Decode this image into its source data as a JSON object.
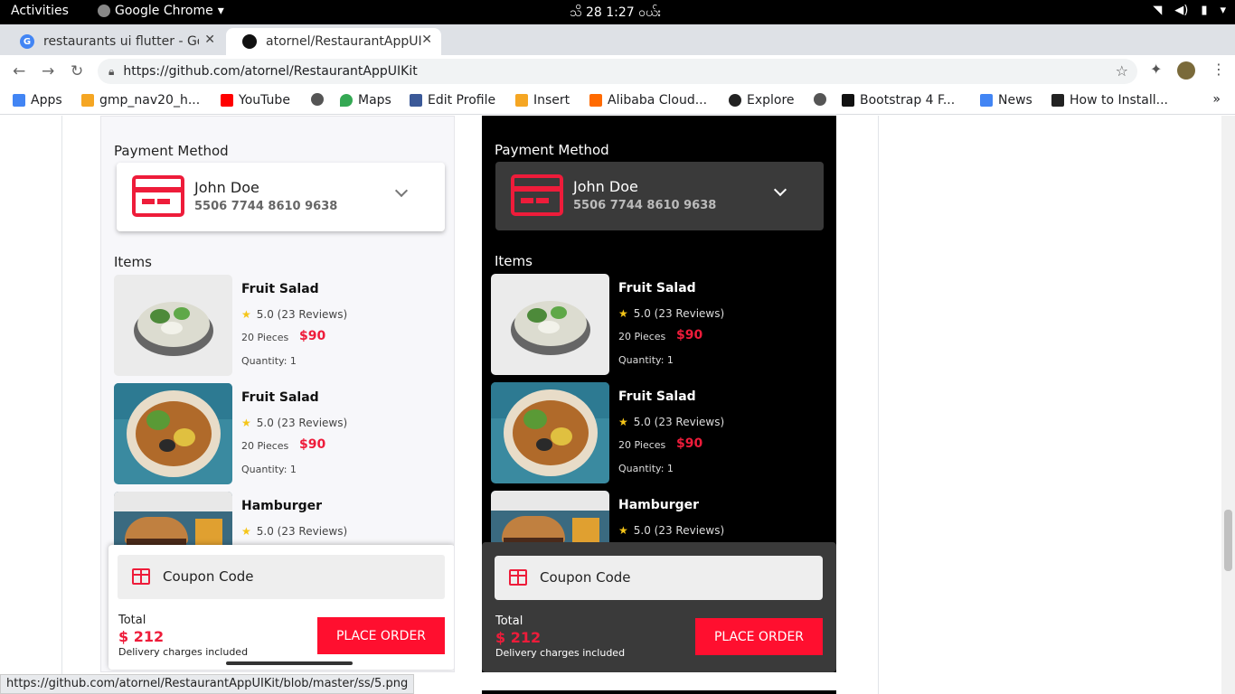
{
  "system": {
    "activities": "Activities",
    "app_name": "Google Chrome",
    "clock": "သိ 28   1:27 ဝယ်း"
  },
  "browser": {
    "tabs": [
      {
        "title": "restaurants ui flutter - Go"
      },
      {
        "title": "atornel/RestaurantAppUI"
      }
    ],
    "url": "https://github.com/atornel/RestaurantAppUIKit",
    "bookmarks": [
      {
        "label": "Apps",
        "color": "#4285f4"
      },
      {
        "label": "gmp_nav20_h...",
        "color": "#f5a623"
      },
      {
        "label": "YouTube",
        "color": "#ff0000"
      },
      {
        "label": "",
        "color": "#555555"
      },
      {
        "label": "Maps",
        "color": "#34a853"
      },
      {
        "label": "Edit Profile",
        "color": "#3b5998"
      },
      {
        "label": "Insert",
        "color": "#f5a623"
      },
      {
        "label": "Alibaba Cloud...",
        "color": "#ff6a00"
      },
      {
        "label": "Explore",
        "color": "#222222"
      },
      {
        "label": "",
        "color": "#555555"
      },
      {
        "label": "Bootstrap 4 F...",
        "color": "#111111"
      },
      {
        "label": "News",
        "color": "#4285f4"
      },
      {
        "label": "How to Install...",
        "color": "#222222"
      }
    ],
    "status_url": "https://github.com/atornel/RestaurantAppUIKit/blob/master/ss/5.png"
  },
  "app": {
    "payment_heading": "Payment Method",
    "card_name": "John Doe",
    "card_number": "5506 7744 8610 9638",
    "items_heading": "Items",
    "items": [
      {
        "name": "Fruit Salad",
        "rating": "5.0 (23 Reviews)",
        "pieces": "20 Pieces",
        "price": "$90",
        "quantity": "Quantity: 1",
        "image": "bowl"
      },
      {
        "name": "Fruit Salad",
        "rating": "5.0 (23 Reviews)",
        "pieces": "20 Pieces",
        "price": "$90",
        "quantity": "Quantity: 1",
        "image": "taco"
      },
      {
        "name": "Hamburger",
        "rating": "5.0 (23 Reviews)",
        "pieces": "",
        "price": "",
        "quantity": "",
        "image": "burger"
      }
    ],
    "coupon": "Coupon Code",
    "total_label": "Total",
    "total_value": "$ 212",
    "delivery_note": "Delivery charges included",
    "order_button": "PLACE ORDER",
    "accent": "#ee1c3a"
  }
}
